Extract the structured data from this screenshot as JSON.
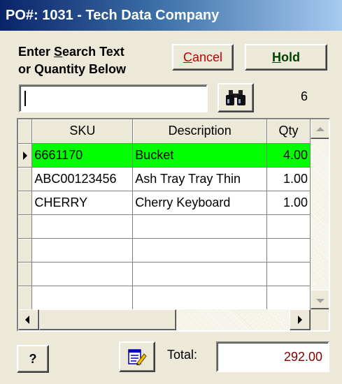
{
  "window": {
    "title": "PO#: 1031 - Tech Data Company"
  },
  "prompt": {
    "line1_pre": "Enter ",
    "line1_mnemonic": "S",
    "line1_post": "earch Text",
    "line2": "or Quantity Below"
  },
  "buttons": {
    "cancel": {
      "mnemonic": "C",
      "rest": "ancel"
    },
    "hold": {
      "mnemonic": "H",
      "rest": "old"
    },
    "help": "?"
  },
  "search": {
    "value": ""
  },
  "item_count": "6",
  "grid": {
    "columns": [
      "SKU",
      "Description",
      "Qty"
    ],
    "rows": [
      {
        "sku": "6661170",
        "description": "Bucket",
        "qty": "4.00",
        "selected": true
      },
      {
        "sku": "ABC00123456",
        "description": "Ash Tray Tray Thin",
        "qty": "1.00"
      },
      {
        "sku": "CHERRY",
        "description": "Cherry Keyboard",
        "qty": "1.00"
      }
    ]
  },
  "icons": [
    "binoculars-icon",
    "edit-notepad-icon",
    "scroll-up-icon",
    "scroll-down-icon",
    "scroll-left-icon",
    "scroll-right-icon"
  ],
  "colors": {
    "selected_row": "#00ff00",
    "title_start": "#0a246a",
    "cancel_text": "#c00000",
    "total_text": "#800000"
  },
  "footer": {
    "total_label": "Total:",
    "total_value": "292.00"
  }
}
